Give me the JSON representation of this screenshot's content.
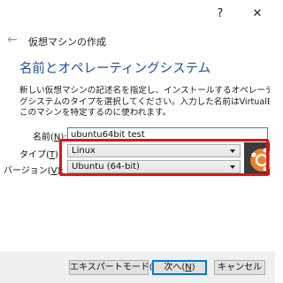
{
  "window": {
    "help_label": "?",
    "close_label": "✕"
  },
  "nav": {
    "back_label": "←",
    "title": "仮想マシンの作成"
  },
  "page": {
    "heading": "名前とオペレーティングシステム",
    "description_lines": [
      "新しい仮想マシンの記述名を指定し、インストールするオペレーティン",
      "グシステムのタイプを選択してください。入力した名前はVirtualBoxで",
      "このマシンを特定するのに使われます。"
    ]
  },
  "form": {
    "name_label": "名前(",
    "name_key": "N",
    "name_label_end": "):",
    "name_value": "ubuntu64bit test",
    "type_label": "タイプ(",
    "type_key": "T",
    "type_label_end": "):",
    "type_value": "Linux",
    "version_label": "バージョン(",
    "version_key": "V",
    "version_label_end": "):",
    "version_value": "Ubuntu (64-bit)"
  },
  "buttons": {
    "expert_label": "エキスパートモード(",
    "expert_key": "E",
    "expert_end": ")",
    "next_label": "次へ(",
    "next_key": "N",
    "next_end": ")",
    "cancel_label": "キャンセル"
  },
  "colors": {
    "heading": "#1e4f9a",
    "highlight": "#e01414",
    "default_button_border": "#0078d7"
  },
  "icons": {
    "os_type": "ubuntu-logo-icon",
    "back": "back-arrow-icon"
  }
}
